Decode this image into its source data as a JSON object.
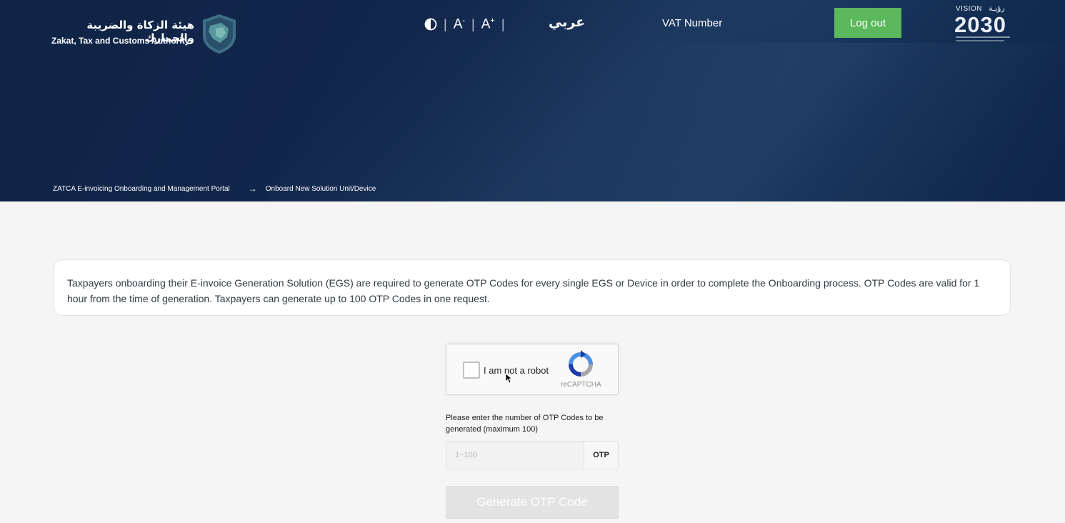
{
  "header": {
    "org_name_ar": "هيئة الزكاة والضريبة والجمارك",
    "org_name_en": "Zakat, Tax and Customs Authority",
    "font_decrease_label": "A",
    "font_decrease_sup": "-",
    "font_increase_label": "A",
    "font_increase_sup": "+",
    "language_toggle": "عربي",
    "vat_label": "VAT Number",
    "logout_label": "Log out",
    "vision_top": "VISION",
    "vision_ar": "رؤيـة",
    "vision_year": "2030"
  },
  "breadcrumb": {
    "home": "ZATCA E-invoicing Onboarding and Management Portal",
    "arrow": "→",
    "current": "Onboard New Solution Unit/Device"
  },
  "info_text": "Taxpayers onboarding their E-invoice Generation Solution (EGS) are required to generate OTP Codes for every single EGS or Device in order to complete the Onboarding process. OTP Codes are valid for 1 hour from the time of generation. Taxpayers can generate up to 100 OTP Codes in one request.",
  "captcha": {
    "label": "I am not a robot",
    "brand": "reCAPTCHA"
  },
  "otp": {
    "label": "Please enter the number of OTP Codes to be generated (maximum 100)",
    "placeholder": "1~100",
    "addon": "OTP",
    "generate_label": "Generate OTP Code"
  },
  "colors": {
    "header_bg": "#12284d",
    "logout_bg": "#5cb85c",
    "page_bg": "#f6f5f5",
    "disabled_button": "#e3e3e3"
  }
}
